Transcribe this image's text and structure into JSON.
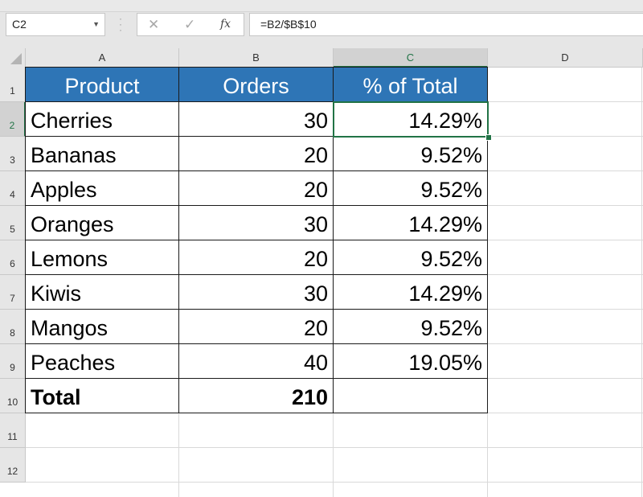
{
  "formula_bar": {
    "name_box": "C2",
    "cancel_icon": "✕",
    "enter_icon": "✓",
    "fx_label": "fx",
    "formula": "=B2/$B$10"
  },
  "columns": [
    "A",
    "B",
    "C",
    "D"
  ],
  "active_column": "C",
  "rows": [
    "1",
    "2",
    "3",
    "4",
    "5",
    "6",
    "7",
    "8",
    "9",
    "10",
    "11",
    "12"
  ],
  "active_row": "2",
  "table": {
    "headers": [
      "Product",
      "Orders",
      "% of Total"
    ],
    "data": [
      {
        "product": "Cherries",
        "orders": "30",
        "pct": "14.29%"
      },
      {
        "product": "Bananas",
        "orders": "20",
        "pct": "9.52%"
      },
      {
        "product": "Apples",
        "orders": "20",
        "pct": "9.52%"
      },
      {
        "product": "Oranges",
        "orders": "30",
        "pct": "14.29%"
      },
      {
        "product": "Lemons",
        "orders": "20",
        "pct": "9.52%"
      },
      {
        "product": "Kiwis",
        "orders": "30",
        "pct": "14.29%"
      },
      {
        "product": "Mangos",
        "orders": "20",
        "pct": "9.52%"
      },
      {
        "product": "Peaches",
        "orders": "40",
        "pct": "19.05%"
      }
    ],
    "total": {
      "label": "Total",
      "orders": "210",
      "pct": ""
    }
  },
  "colors": {
    "header_fill": "#2e75b6",
    "selection": "#217346"
  }
}
